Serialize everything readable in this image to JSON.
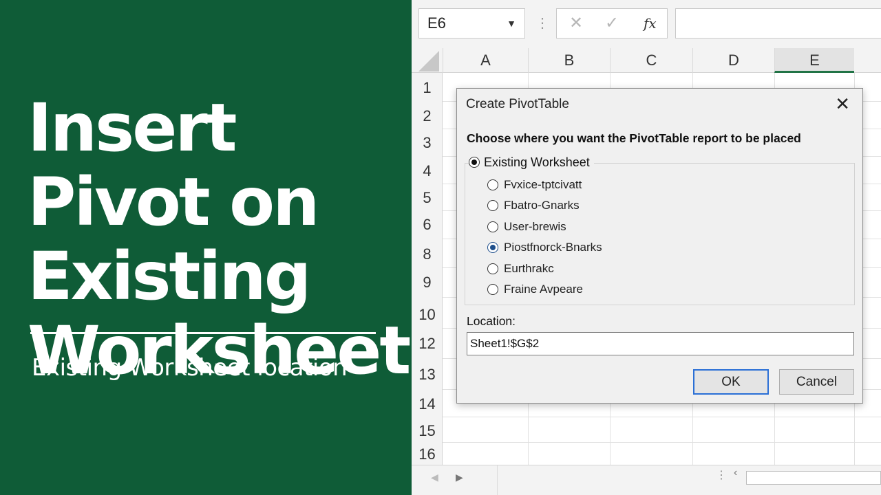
{
  "promo": {
    "title": "Insert Pivot on Existing Worksheet",
    "subtitle": "Existing Worksheet location",
    "bg_color": "#0f5c37"
  },
  "formula_bar": {
    "name_box": "E6",
    "cancel_icon": "✕",
    "enter_icon": "✓",
    "function_icon": "fx",
    "formula": ""
  },
  "sheet": {
    "columns": [
      "A",
      "B",
      "C",
      "D",
      "E"
    ],
    "selected_column": "E",
    "rows": [
      "1",
      "2",
      "3",
      "4",
      "5",
      "6",
      "8",
      "9",
      "10",
      "12",
      "13",
      "14",
      "15",
      "16"
    ]
  },
  "dialog": {
    "title": "Create PivotTable",
    "heading": "Choose where you want the PivotTable report to be placed",
    "group_label": "Existing Worksheet",
    "options": [
      {
        "label": "Fvxice-tptcivatt",
        "selected": false
      },
      {
        "label": "Fbatro-Gnarks",
        "selected": false
      },
      {
        "label": "User-brewis",
        "selected": false
      },
      {
        "label": "Piostfnorck-Bnarks",
        "selected": true
      },
      {
        "label": "Eurthrakc",
        "selected": false
      },
      {
        "label": "Fraine Avpeare",
        "selected": false
      }
    ],
    "location_label": "Location:",
    "location_value": "Sheet1!$G$2",
    "ok_label": "OK",
    "cancel_label": "Cancel",
    "accent_color": "#2a6fd6"
  }
}
